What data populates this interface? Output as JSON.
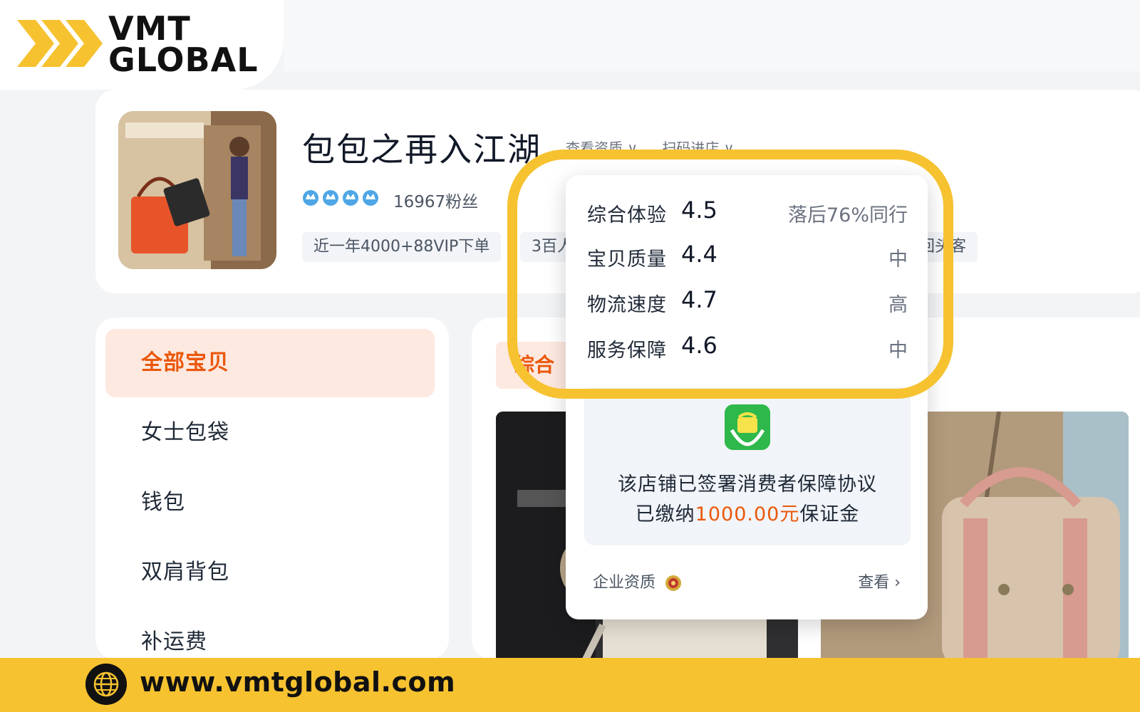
{
  "brand": {
    "line1": "VMT",
    "line2": "GLOBAL",
    "accent_color": "#f6c230",
    "url": "www.vmtglobal.com",
    "url_icon": "globe-icon"
  },
  "shop": {
    "name": "包包之再入江湖",
    "links": [
      "查看资质 ∨",
      "扫码进店 ∨"
    ],
    "crown_count": 4,
    "fans": "16967粉丝",
    "tags": [
      "近一年4000+88VIP下单",
      "3百人",
      "回头客"
    ]
  },
  "popup": {
    "ratings": [
      {
        "label": "综合体验",
        "value": "4.5",
        "note": "落后76%同行"
      },
      {
        "label": "宝贝质量",
        "value": "4.4",
        "note": "中"
      },
      {
        "label": "物流速度",
        "value": "4.7",
        "note": "高"
      },
      {
        "label": "服务保障",
        "value": "4.6",
        "note": "中"
      }
    ],
    "guarantee": {
      "icon": "shield-bag-icon",
      "line1": "该店铺已签署消费者保障协议",
      "line2_prefix": "已缴纳",
      "amount": "1000.00元",
      "line2_suffix": "保证金"
    },
    "qualification_label": "企业资质",
    "view_label": "查看 ›"
  },
  "categories": [
    "全部宝贝",
    "女士包袋",
    "钱包",
    "双肩背包",
    "补运费"
  ],
  "products": {
    "sort_tab": "综合"
  }
}
